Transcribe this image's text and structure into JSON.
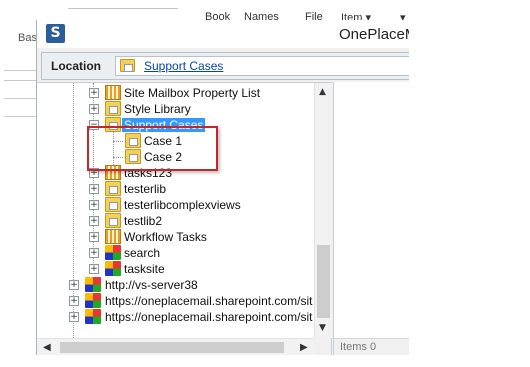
{
  "background": {
    "ribbon_items": [
      "Book",
      "Names",
      "File",
      "Item ▾",
      "▾"
    ],
    "left_label": "Bas"
  },
  "dialog": {
    "logo": "S",
    "title": "OnePlaceM",
    "location_label": "Location",
    "location_value": "Support Cases"
  },
  "tree": {
    "items": [
      {
        "label": "Site Mailbox Property List",
        "icon": "list-icon",
        "expanded": false
      },
      {
        "label": "Style Library",
        "icon": "folder-icon",
        "expanded": false
      },
      {
        "label": "Support Cases",
        "icon": "folder-icon",
        "expanded": true,
        "selected": true
      },
      {
        "label": "Case 1",
        "icon": "folder-icon"
      },
      {
        "label": "Case 2",
        "icon": "folder-icon"
      },
      {
        "label": "tasks123",
        "icon": "list-icon",
        "expanded": false
      },
      {
        "label": "testerlib",
        "icon": "folder-icon",
        "expanded": false
      },
      {
        "label": "testerlibcomplexviews",
        "icon": "folder-icon",
        "expanded": false
      },
      {
        "label": "testlib2",
        "icon": "folder-icon",
        "expanded": false
      },
      {
        "label": "Workflow Tasks",
        "icon": "list-icon",
        "expanded": false
      },
      {
        "label": "search",
        "icon": "site-icon",
        "expanded": false
      },
      {
        "label": "tasksite",
        "icon": "site-icon",
        "expanded": false
      },
      {
        "label": "http://vs-server38",
        "icon": "site-icon",
        "expanded": false
      },
      {
        "label": "https://oneplacemail.sharepoint.com/sites/i",
        "icon": "site-icon",
        "expanded": false
      },
      {
        "label": "https://oneplacemail.sharepoint.com/sites/t",
        "icon": "site-icon",
        "expanded": false
      }
    ]
  },
  "status": {
    "items": "Items 0"
  },
  "colors": {
    "highlight_box": "#c0282d",
    "selection": "#3399ff",
    "link": "#0645ad"
  }
}
